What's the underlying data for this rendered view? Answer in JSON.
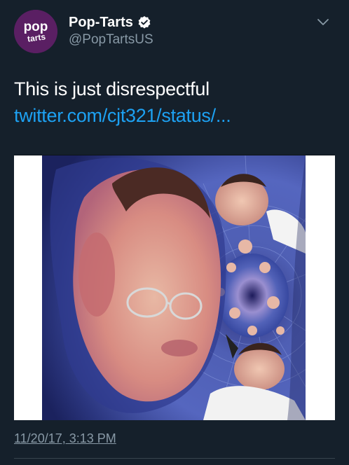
{
  "colors": {
    "background": "#15202b",
    "name": "#ffffff",
    "muted": "#8899a6",
    "link": "#1da1f2",
    "avatar_bg": "#5a1f63"
  },
  "user": {
    "avatar_text_top": "pop",
    "avatar_text_bottom": "tarts",
    "display_name": "Pop-Tarts",
    "handle": "@PopTartsUS",
    "verified_icon": "verified-badge-icon"
  },
  "tweet": {
    "text": "This is just disrespectful",
    "link_text": "twitter.com/cjt321/status/...",
    "timestamp": "11/20/17, 3:13 PM"
  },
  "menu_icon": "chevron-down-icon"
}
